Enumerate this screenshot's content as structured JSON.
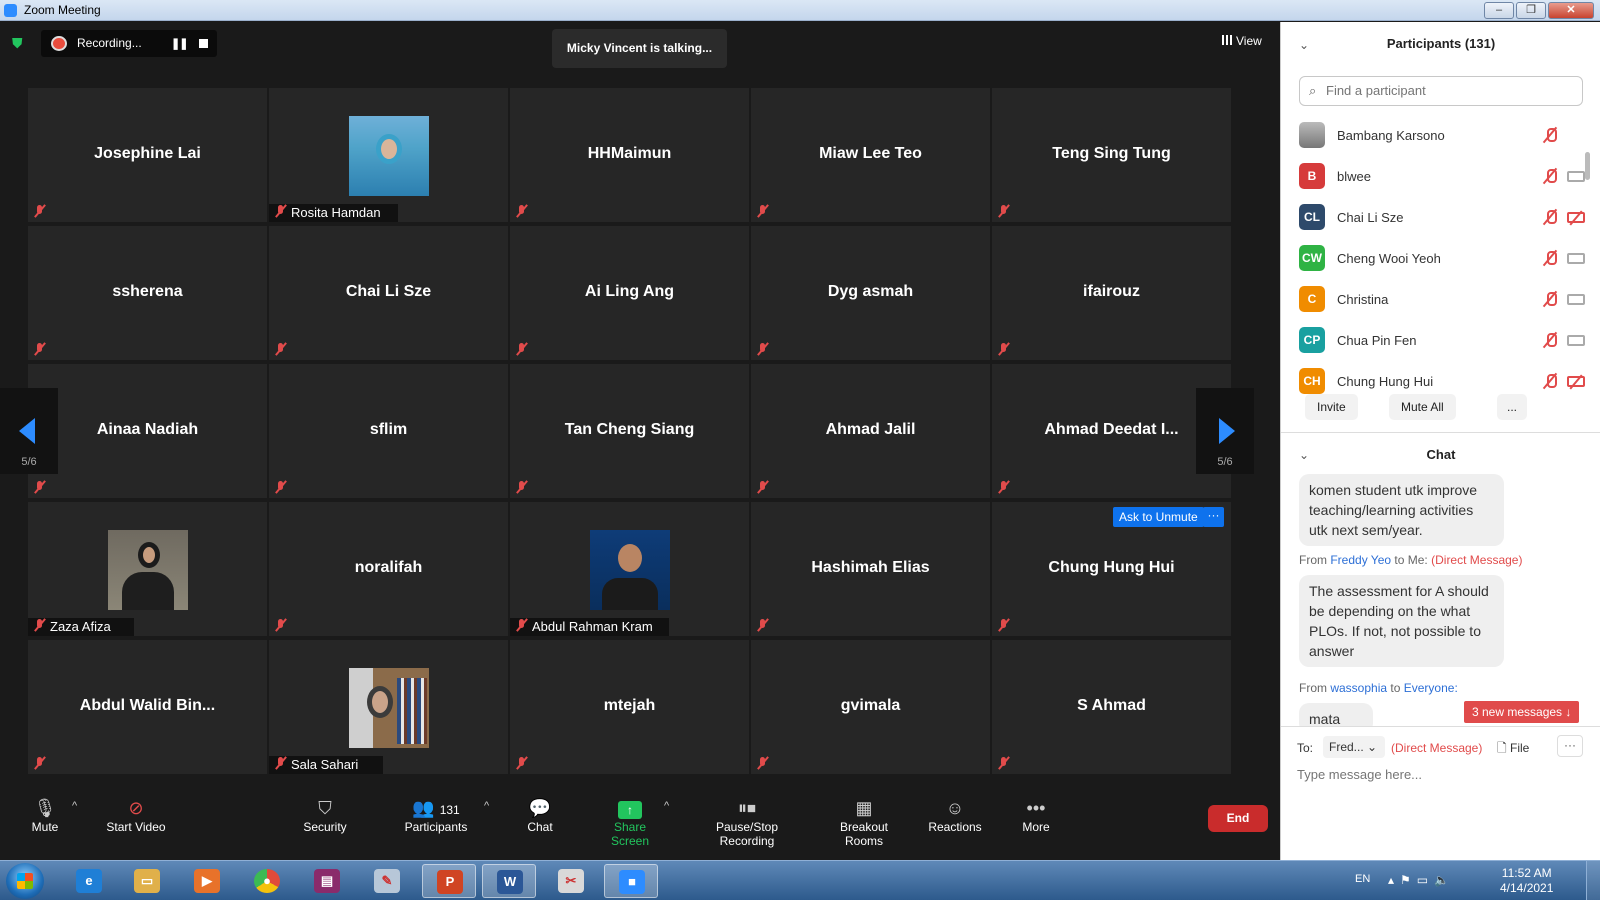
{
  "window": {
    "title": "Zoom Meeting",
    "buttons": [
      "–",
      "❐",
      "✕"
    ]
  },
  "top": {
    "recording_label": "Recording...",
    "talking": "Micky Vincent is talking...",
    "view_label": "View"
  },
  "tiles": [
    {
      "name": "Josephine Lai"
    },
    {
      "name": "Rosita Hamdan",
      "photo": true
    },
    {
      "name": "HHMaimun"
    },
    {
      "name": "Miaw Lee Teo"
    },
    {
      "name": "Teng Sing Tung"
    },
    {
      "name": "ssherena"
    },
    {
      "name": "Chai Li Sze"
    },
    {
      "name": "Ai Ling Ang"
    },
    {
      "name": "Dyg asmah"
    },
    {
      "name": "ifairouz"
    },
    {
      "name": "Ainaa Nadiah"
    },
    {
      "name": "sflim"
    },
    {
      "name": "Tan Cheng Siang"
    },
    {
      "name": "Ahmad Jalil"
    },
    {
      "name": "Ahmad Deedat I..."
    },
    {
      "name": "Zaza Afiza",
      "photo": true
    },
    {
      "name": "noralifah"
    },
    {
      "name": "Abdul Rahman Kram",
      "photo": true
    },
    {
      "name": "Hashimah Elias"
    },
    {
      "name": "Chung Hung Hui"
    },
    {
      "name": "Abdul Walid Bin..."
    },
    {
      "name": "Sala Sahari",
      "photo": true
    },
    {
      "name": "mtejah"
    },
    {
      "name": "gvimala"
    },
    {
      "name": "S Ahmad"
    }
  ],
  "ask_unmute": {
    "label": "Ask to Unmute",
    "more": "···"
  },
  "paging": {
    "left": "5/6",
    "right": "5/6"
  },
  "toolbar": {
    "mute": "Mute",
    "start_video": "Start Video",
    "security": "Security",
    "participants": "Participants",
    "participants_count": "131",
    "chat": "Chat",
    "share_screen": "Share Screen",
    "pause_stop_recording": "Pause/Stop Recording",
    "breakout_rooms": "Breakout Rooms",
    "reactions": "Reactions",
    "more": "More",
    "end": "End"
  },
  "participants_panel": {
    "title": "Participants (131)",
    "search_placeholder": "Find a participant",
    "list": [
      {
        "name": "Bambang Karsono",
        "initials": "",
        "color": "#999999",
        "cam": "none"
      },
      {
        "name": "blwee",
        "initials": "B",
        "color": "#d63b3b",
        "cam": "on"
      },
      {
        "name": "Chai Li Sze",
        "initials": "CL",
        "color": "#2e4a6b",
        "cam": "off"
      },
      {
        "name": "Cheng Wooi Yeoh",
        "initials": "CW",
        "color": "#2fb344",
        "cam": "on"
      },
      {
        "name": "Christina",
        "initials": "C",
        "color": "#f08c00",
        "cam": "on"
      },
      {
        "name": "Chua Pin Fen",
        "initials": "CP",
        "color": "#19a0a0",
        "cam": "on"
      },
      {
        "name": "Chung Hung Hui",
        "initials": "CH",
        "color": "#f08c00",
        "cam": "off"
      }
    ],
    "invite": "Invite",
    "mute_all": "Mute All",
    "more": "..."
  },
  "chat_panel": {
    "title": "Chat",
    "msg1": "komen student utk improve teaching/learning activities utk next sem/year.",
    "from2_prefix": "From",
    "from2_sender": "Freddy Yeo",
    "from2_to": "to Me:",
    "from2_dm": "(Direct Message)",
    "msg2": "The assessment for A should be depending on the what PLOs. If not, not possible to answer",
    "from3_prefix": "From",
    "from3_sender": "wassophia",
    "from3_to": "to",
    "from3_target": "Everyone:",
    "msg3_partial": "mata",
    "new_messages": "3 new messages ↓",
    "to_label": "To:",
    "to_value": "Fred...",
    "dm_tag": "(Direct Message)",
    "file_label": "File",
    "more": "···",
    "input_placeholder": "Type message here..."
  },
  "taskbar": {
    "lang": "EN",
    "time": "11:52 AM",
    "date": "4/14/2021"
  }
}
